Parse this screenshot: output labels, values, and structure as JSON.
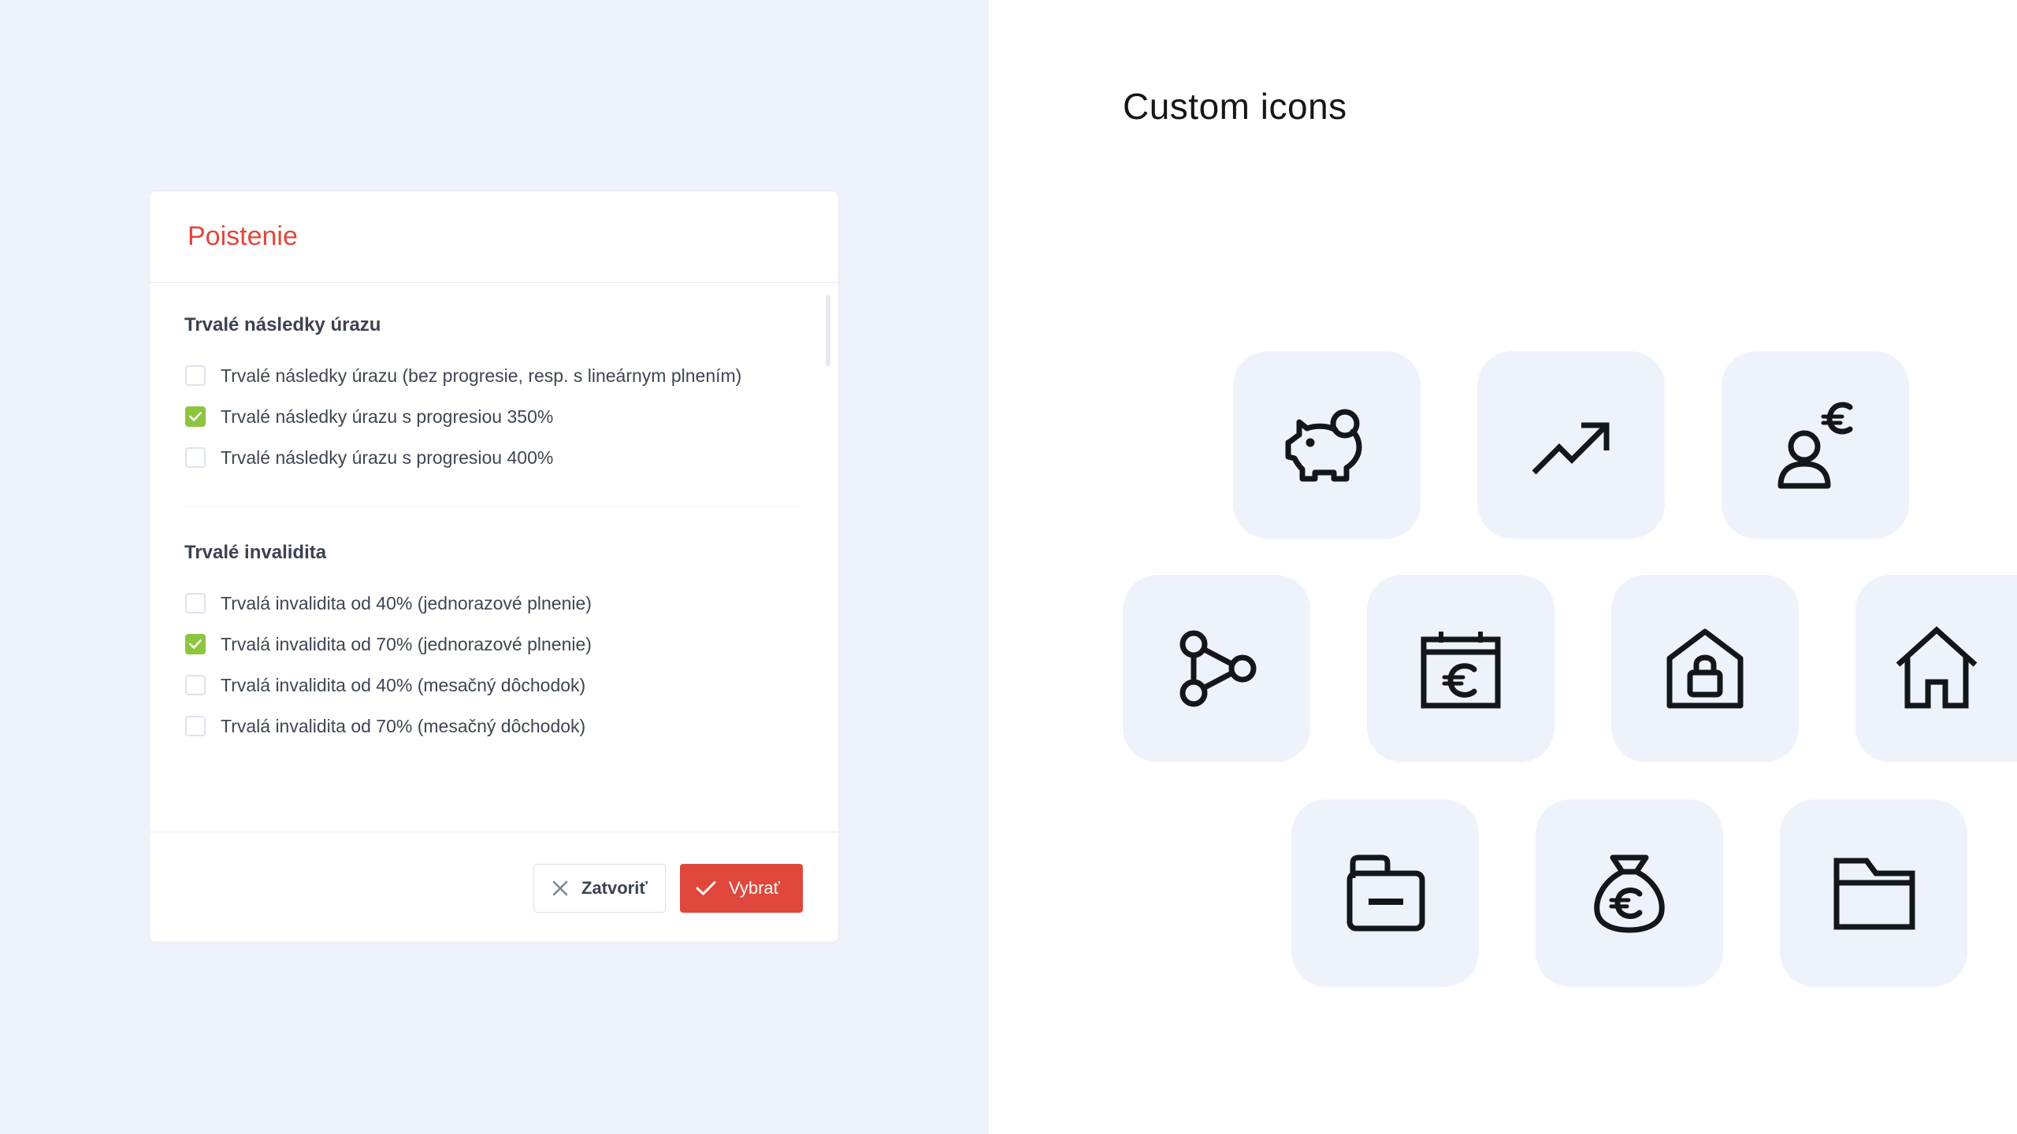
{
  "dialog": {
    "title": "Poistenie",
    "sections": [
      {
        "heading": "Trvalé následky úrazu",
        "options": [
          {
            "label": "Trvalé následky úrazu (bez progresie, resp. s lineárnym plnením)",
            "checked": false
          },
          {
            "label": "Trvalé následky úrazu s progresiou 350%",
            "checked": true
          },
          {
            "label": "Trvalé následky úrazu s progresiou 400%",
            "checked": false
          }
        ]
      },
      {
        "heading": "Trvalé invalidita",
        "options": [
          {
            "label": "Trvalá invalidita od 40% (jednorazové plnenie)",
            "checked": false
          },
          {
            "label": "Trvalá invalidita od 70% (jednorazové plnenie)",
            "checked": true
          },
          {
            "label": "Trvalá invalidita od 40% (mesačný dôchodok)",
            "checked": false
          },
          {
            "label": "Trvalá invalidita od 70% (mesačný dôchodok)",
            "checked": false
          }
        ]
      }
    ],
    "buttons": {
      "close_label": "Zatvoriť",
      "select_label": "Vybrať"
    }
  },
  "icons_section": {
    "heading": "Custom icons",
    "icons": [
      "piggy-bank-icon",
      "trending-up-icon",
      "user-euro-icon",
      "share-nodes-icon",
      "calendar-euro-icon",
      "house-lock-icon",
      "home-icon",
      "wallet-icon",
      "money-bag-euro-icon",
      "folder-icon"
    ]
  },
  "colors": {
    "accent": "#e0473c",
    "checkbox_checked": "#8cc63f",
    "panel_background": "#eef3fb",
    "text": "#3e4652"
  }
}
